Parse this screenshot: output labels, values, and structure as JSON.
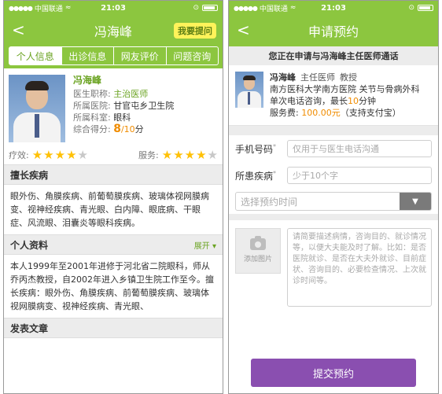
{
  "status": {
    "carrier": "中国联通",
    "time": "21:03"
  },
  "left": {
    "title": "冯海峰",
    "ask_button": "我要提问",
    "tabs": [
      "个人信息",
      "出诊信息",
      "网友评价",
      "问题咨询"
    ],
    "doctor": {
      "name": "冯海峰",
      "title_label": "医生职称:",
      "title_value": "主治医师",
      "hospital_label": "所属医院:",
      "hospital_value": "甘官屯乡卫生院",
      "dept_label": "所属科室:",
      "dept_value": "眼科",
      "score_label": "综合得分:",
      "score_value": "8",
      "score_total": "/10",
      "score_unit": "分"
    },
    "ratings": {
      "effect_label": "疗效:",
      "effect_stars": 4,
      "service_label": "服务:",
      "service_stars": 4,
      "max_stars": 5
    },
    "specialty_header": "擅长疾病",
    "specialty_text": "眼外伤、角膜疾病、前葡萄膜疾病、玻璃体视网膜病变、视神经疾病、青光眼、白内障、眼底病、干眼症、风流眼、泪囊炎等眼科疾病。",
    "profile_header": "个人资料",
    "expand_label": "展开 ▾",
    "profile_text": "本人1999年至2001年进修于河北省二院眼科，师从乔丙杰教授，自2002年进入乡镇卫生院工作至今。擅长疾病：眼外伤、角膜疾病、前葡萄膜疾病、玻璃体视网膜病变、视神经疾病、青光眼、",
    "articles_header": "发表文章"
  },
  "right": {
    "title": "申请预约",
    "notice": "您正在申请与冯海峰主任医师通话",
    "doctor": {
      "name": "冯海峰",
      "title": "主任医师",
      "rank": "教授",
      "hospital": "南方医科大学南方医院 关节与骨病外科",
      "consult_prefix": "单次电话咨询，最长",
      "consult_minutes": "10",
      "consult_suffix": "分钟",
      "fee_label": "服务费:",
      "fee_value": "100.00元",
      "fee_note": "（支持支付宝）"
    },
    "form": {
      "phone_label": "手机号码",
      "phone_placeholder": "仅用于与医生电话沟通",
      "disease_label": "所患疾病",
      "disease_placeholder": "少于10个字",
      "time_placeholder": "选择预约时间",
      "add_photo": "添加图片",
      "desc_placeholder": "请简要描述病情，咨询目的、就诊情况等，以便大夫能及时了解。比如：是否医院就诊、是否在大夫外就诊、目前症状、咨询目的、必要检查情况、上次就诊时间等。",
      "required_mark": "*"
    },
    "submit": "提交预约"
  },
  "colors": {
    "brand_green": "#8cc63f",
    "accent_orange": "#f08c00",
    "submit_purple": "#8a4fb0",
    "star_yellow": "#ffc107"
  }
}
